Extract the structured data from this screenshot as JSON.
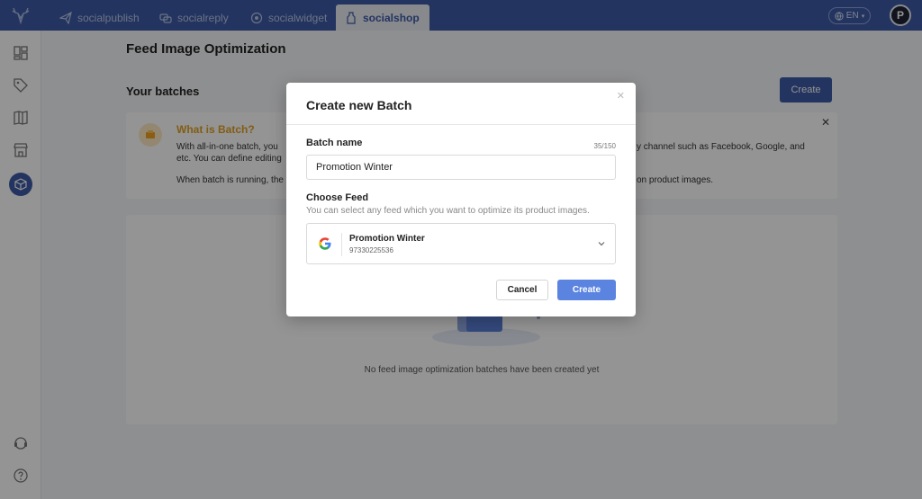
{
  "topbar": {
    "tabs": [
      {
        "label": "socialpublish",
        "icon": "paper-plane-icon"
      },
      {
        "label": "socialreply",
        "icon": "chat-bubbles-icon"
      },
      {
        "label": "socialwidget",
        "icon": "widget-icon"
      },
      {
        "label": "socialshop",
        "icon": "shopping-tag-icon"
      }
    ],
    "active_tab": "socialshop",
    "language": "EN",
    "avatar_initial": "P",
    "brand_color": "#3d5aa6"
  },
  "sidebar": {
    "icons": [
      "dashboard-icon",
      "tag-icon",
      "catalog-icon",
      "store-icon",
      "feed-optimization-icon",
      "support-icon",
      "help-icon"
    ],
    "active": "feed-optimization-icon"
  },
  "page": {
    "title": "Feed Image Optimization",
    "section_title": "Your batches",
    "create_label": "Create",
    "info": {
      "title": "What is Batch?",
      "line1_left": "With all-in-one batch, you",
      "line1_right": "y channel such as Facebook, Google, and",
      "line2": "etc. You can define editing",
      "line3_left": "When batch is running, the",
      "line3_right": "on product images."
    },
    "empty_text": "No feed image optimization batches have been created yet"
  },
  "modal": {
    "title": "Create new Batch",
    "batch_name_label": "Batch name",
    "counter": "35/150",
    "batch_name_value": "Promotion Winter",
    "choose_feed_label": "Choose Feed",
    "choose_feed_helper": "You can select any feed which you want to optimize its product images.",
    "feed": {
      "name": "Promotion Winter",
      "id": "97330225536",
      "icon": "google-icon"
    },
    "cancel_label": "Cancel",
    "create_label": "Create",
    "create_color": "#5b84e0"
  }
}
